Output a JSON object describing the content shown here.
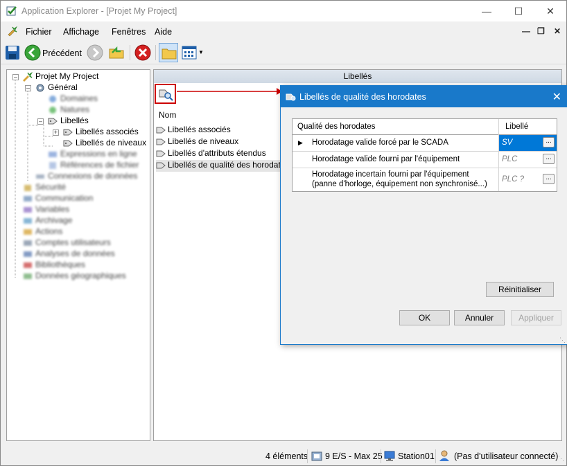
{
  "window": {
    "title": "Application Explorer - [Projet My Project]"
  },
  "menu": {
    "items": [
      "Fichier",
      "Affichage",
      "Fenêtres",
      "Aide"
    ]
  },
  "toolbar": {
    "back_label": "Précédent"
  },
  "tree": {
    "root": "Projet My Project",
    "general": "Général",
    "blur1": "Domaines",
    "blur2": "Natures",
    "libelles": "Libellés",
    "libelles_associes": "Libellés associés",
    "libelles_niveaux": "Libellés de niveaux",
    "blur3": "Expressions en ligne",
    "blur4": "Références de fichier",
    "blur5": "Connexions de données",
    "blur6": "Sécurité",
    "blur7": "Communication",
    "blur8": "Variables",
    "blur9": "Archivage",
    "blur10": "Actions",
    "blur11": "Comptes utilisateurs",
    "blur12": "Analyses de données",
    "blur13": "Bibliothèques",
    "blur14": "Données géographiques"
  },
  "pane": {
    "header": "Libellés",
    "column": "Nom",
    "items": [
      "Libellés associés",
      "Libellés de niveaux",
      "Libellés d'attributs étendus",
      "Libellés de qualité des horodates"
    ]
  },
  "dialog": {
    "title": "Libellés de qualité des horodates",
    "col1": "Qualité des horodates",
    "col2": "Libellé",
    "rows": [
      {
        "name": "Horodatage valide forcé par le SCADA",
        "value": "SV"
      },
      {
        "name": "Horodatage valide fourni par l'équipement",
        "value": "PLC"
      },
      {
        "name": "Horodatage incertain fourni par l'équipement",
        "name2": "(panne d'horloge, équipement non synchronisé...)",
        "value": "PLC ?"
      }
    ],
    "ellipsis": "...",
    "reset": "Réinitialiser",
    "ok": "OK",
    "cancel": "Annuler",
    "apply": "Appliquer"
  },
  "status": {
    "count": "4 éléments",
    "io": "9 E/S - Max 25",
    "station": "Station01",
    "user": "(Pas d'utilisateur connecté)"
  },
  "colors": {
    "accent": "#1979ca",
    "highlight": "#cc0000"
  }
}
